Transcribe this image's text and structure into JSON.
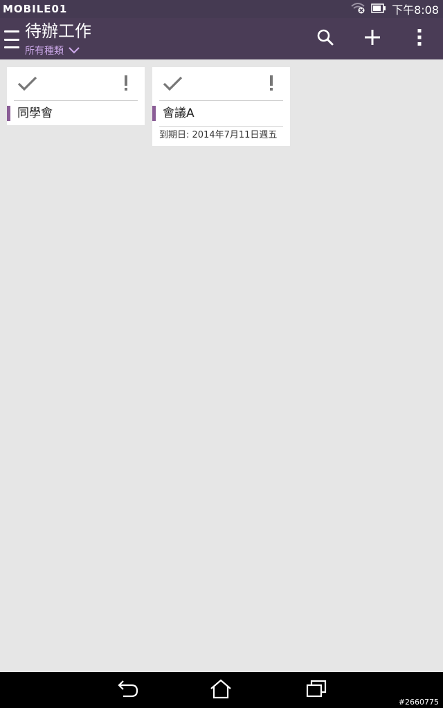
{
  "status_bar": {
    "watermark": "MOBILE01",
    "time": "下午8:08",
    "icons": [
      "wifi-off-icon",
      "battery-icon"
    ]
  },
  "app_bar": {
    "title": "待辦工作",
    "category": "所有種類",
    "actions": [
      "search-icon",
      "add-icon",
      "overflow-menu-icon"
    ]
  },
  "tasks": [
    {
      "title": "同學會",
      "due": ""
    },
    {
      "title": "會議A",
      "due": "到期日: 2014年7月11日週五"
    }
  ],
  "colors": {
    "app_bar": "#4a3c56",
    "status_bar": "#453a52",
    "accent": "#8a5d96",
    "category_text": "#c9a6e6",
    "background": "#e6e6e6"
  },
  "nav_bar": {
    "buttons": [
      "back-icon",
      "home-icon",
      "recent-apps-icon"
    ],
    "post_id": "#2660775"
  }
}
